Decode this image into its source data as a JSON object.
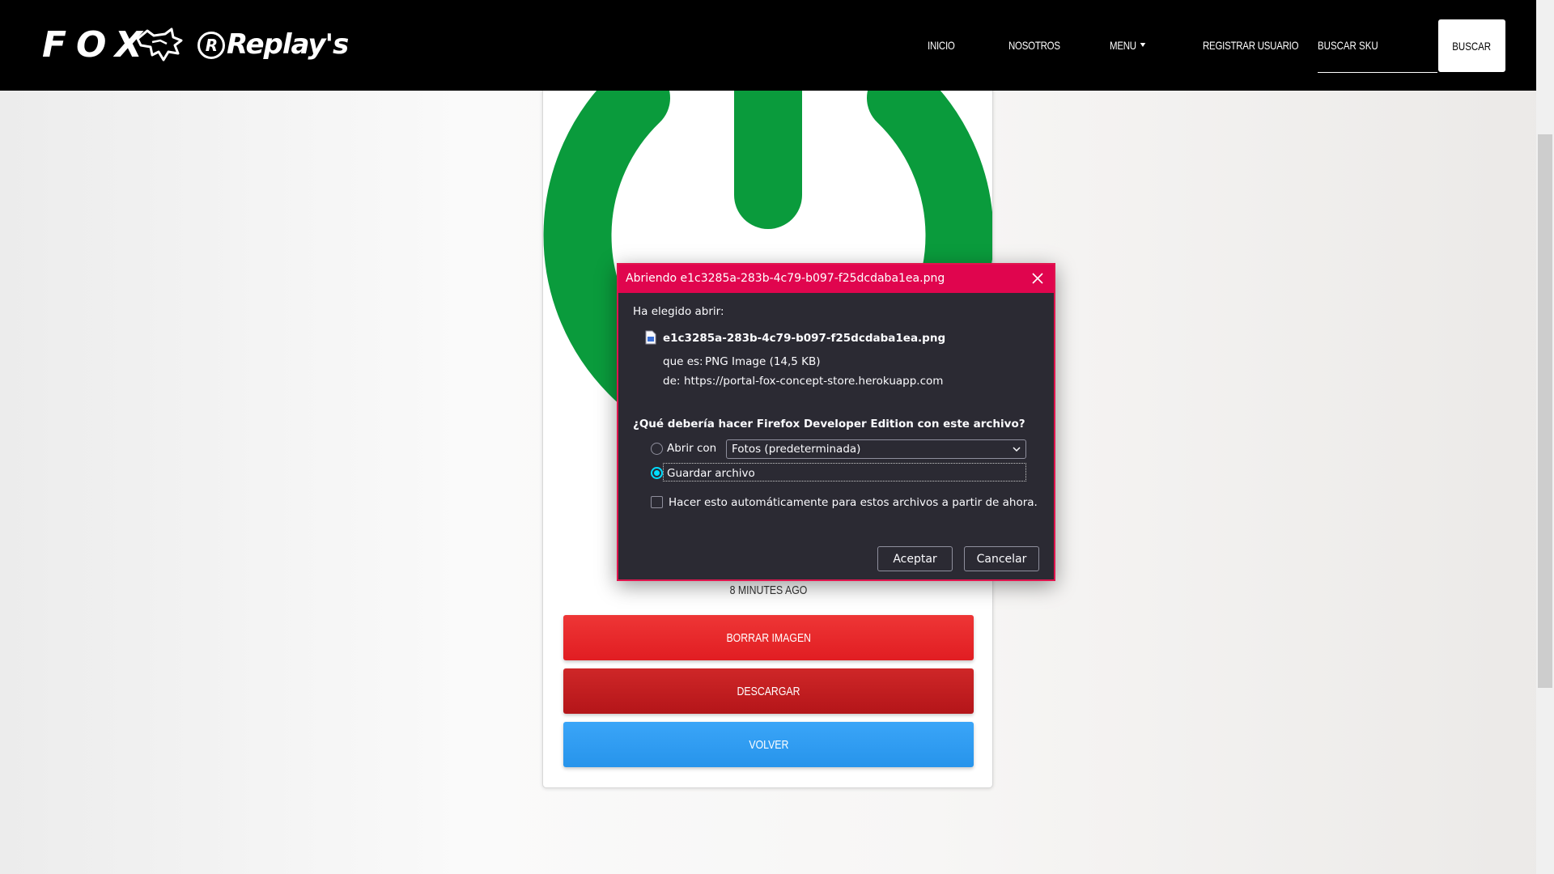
{
  "navbar": {
    "logo_fox": "FOX",
    "logo_replays": "Replay's",
    "logo_replays_mark": "R",
    "items": [
      {
        "label": "INICIO"
      },
      {
        "label": "NOSOTROS"
      },
      {
        "label": "MENU"
      },
      {
        "label": "REGISTRAR USUARIO"
      }
    ],
    "search_placeholder": "BUSCAR SKU",
    "search_button": "BUSCAR"
  },
  "card": {
    "image_icon": "power-icon",
    "image_color": "#0a9b3c",
    "timestamp": "8 MINUTES AGO",
    "buttons": {
      "delete": "BORRAR IMAGEN",
      "download": "DESCARGAR",
      "back": "VOLVER"
    }
  },
  "dialog": {
    "title": "Abriendo e1c3285a-283b-4c79-b097-f25dcdaba1ea.png",
    "intro": "Ha elegido abrir:",
    "filename": "e1c3285a-283b-4c79-b097-f25dcdaba1ea.png",
    "type_label": "que es:",
    "type_value": "PNG Image (14,5 KB)",
    "from_label": "de:",
    "from_value": "https://portal-fox-concept-store.herokuapp.com",
    "question": "¿Qué debería hacer Firefox Developer Edition con este archivo?",
    "open_with_label": "Abrir con",
    "open_with_value": "Fotos (predeterminada)",
    "save_label": "Guardar archivo",
    "save_selected": true,
    "auto_label": "Hacer esto automáticamente para estos archivos a partir de ahora.",
    "auto_checked": false,
    "accept": "Aceptar",
    "cancel": "Cancelar"
  },
  "colors": {
    "navbar_bg": "#000000",
    "dialog_title_bg": "#e0054e",
    "dialog_bg": "#2b2a33",
    "btn_delete": "#e11d22",
    "btn_download": "#b41519",
    "btn_back": "#2794eb",
    "power_icon": "#0a9b3c"
  }
}
